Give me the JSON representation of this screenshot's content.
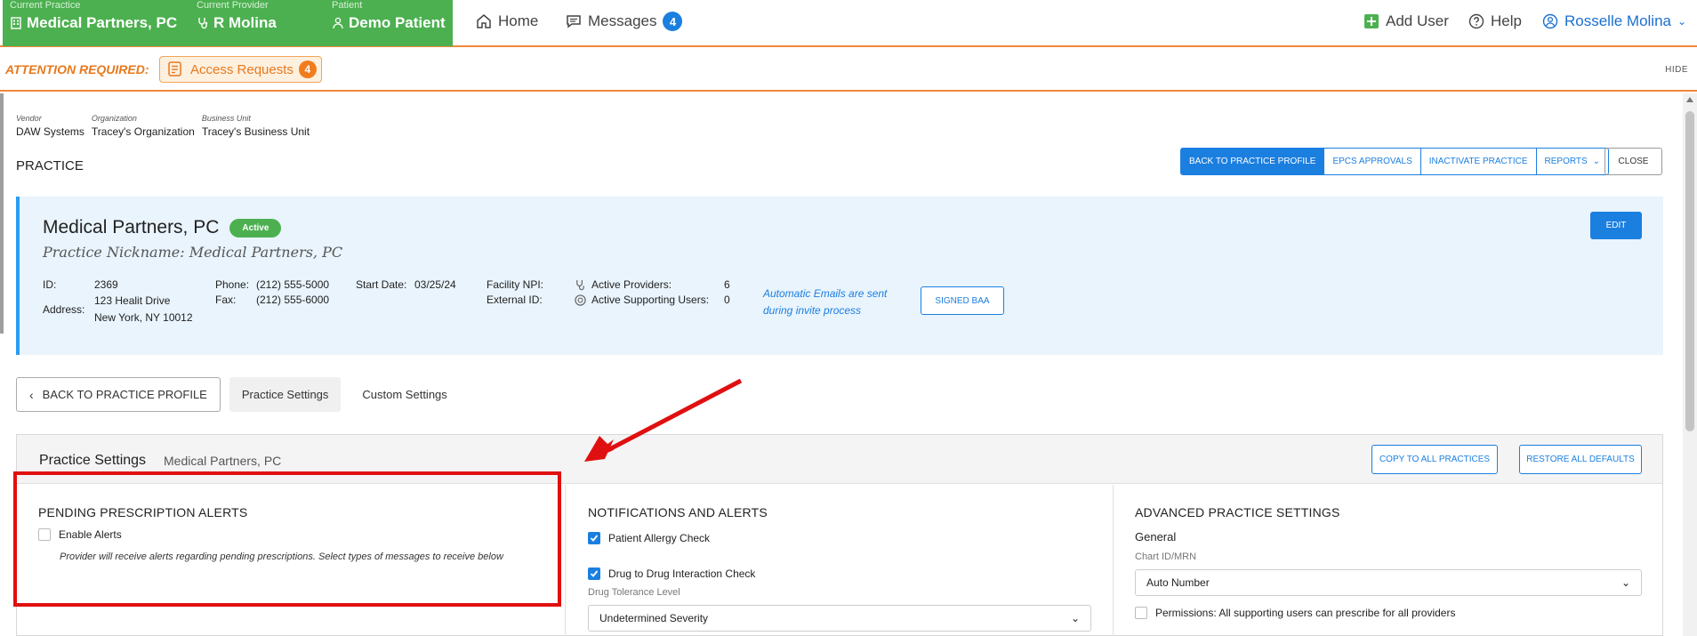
{
  "context": {
    "practice_label": "Current Practice",
    "practice_value": "Medical Partners, PC",
    "provider_label": "Current Provider",
    "provider_value": "R Molina",
    "patient_label": "Patient",
    "patient_value": "Demo Patient"
  },
  "nav": {
    "home": "Home",
    "messages": "Messages",
    "messages_count": "4",
    "add_user": "Add User",
    "help": "Help",
    "user": "Rosselle Molina"
  },
  "attention": {
    "text": "ATTENTION REQUIRED:",
    "access_requests": "Access Requests",
    "access_count": "4",
    "hide": "HIDE"
  },
  "breadcrumb": {
    "vendor_label": "Vendor",
    "vendor_value": "DAW Systems",
    "org_label": "Organization",
    "org_value": "Tracey's Organization",
    "bu_label": "Business Unit",
    "bu_value": "Tracey's Business Unit"
  },
  "page_title": "PRACTICE",
  "actions": {
    "back": "BACK TO PRACTICE PROFILE",
    "epcs": "EPCS APPROVALS",
    "inactivate": "INACTIVATE PRACTICE",
    "reports": "REPORTS",
    "close": "CLOSE"
  },
  "practice": {
    "name": "Medical Partners, PC",
    "status": "Active",
    "nickname": "Practice Nickname: Medical Partners, PC",
    "edit": "EDIT",
    "id_label": "ID:",
    "id_value": "2369",
    "address_label": "Address:",
    "address_line1": "123 Healit Drive",
    "address_line2": "New York, NY 10012",
    "phone_label": "Phone:",
    "phone_value": "(212) 555-5000",
    "fax_label": "Fax:",
    "fax_value": "(212) 555-6000",
    "start_label": "Start Date:",
    "start_value": "03/25/24",
    "npi_label": "Facility NPI:",
    "ext_label": "External ID:",
    "providers_label": "Active Providers:",
    "providers_value": "6",
    "supporting_label": "Active Supporting Users:",
    "supporting_value": "0",
    "auto_email_line1": "Automatic Emails are sent",
    "auto_email_line2": "during invite process",
    "signed_baa": "SIGNED BAA"
  },
  "tabs": {
    "back": "BACK TO PRACTICE PROFILE",
    "practice_settings": "Practice Settings",
    "custom_settings": "Custom Settings"
  },
  "settings": {
    "title": "Practice Settings",
    "subtitle": "Medical Partners, PC",
    "copy_all": "COPY TO ALL PRACTICES",
    "restore": "RESTORE ALL DEFAULTS",
    "pending": {
      "heading": "PENDING PRESCRIPTION ALERTS",
      "enable": "Enable Alerts",
      "enabled": false,
      "desc": "Provider will receive alerts regarding pending prescriptions. Select types of messages to receive below"
    },
    "notifications": {
      "heading": "NOTIFICATIONS AND ALERTS",
      "allergy": "Patient Allergy Check",
      "allergy_on": true,
      "drug": "Drug to Drug Interaction Check",
      "drug_on": true,
      "tolerance_label": "Drug Tolerance Level",
      "tolerance_value": "Undetermined Severity"
    },
    "advanced": {
      "heading": "ADVANCED PRACTICE SETTINGS",
      "general": "General",
      "chart_label": "Chart ID/MRN",
      "chart_value": "Auto Number",
      "permissions": "Permissions: All supporting users can prescribe for all providers",
      "permissions_on": false
    }
  }
}
